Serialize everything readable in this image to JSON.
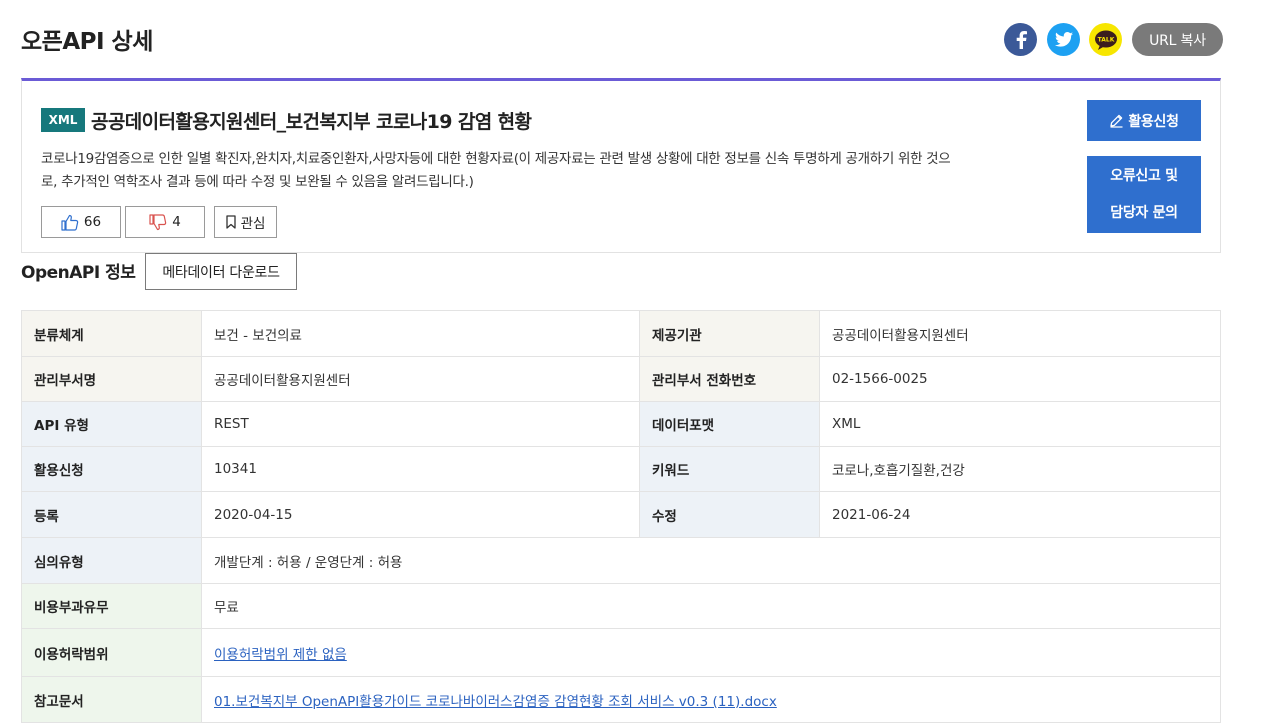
{
  "header": {
    "title": "오픈API 상세",
    "share": {
      "facebook": "facebook-icon",
      "twitter": "twitter-icon",
      "kakao": "kakaotalk-icon",
      "kakao_text": "TALK",
      "url_copy_label": "URL 복사"
    }
  },
  "dataset": {
    "format_badge": "XML",
    "title": "공공데이터활용지원센터_보건복지부 코로나19 감염 현황",
    "description": "코로나19감염증으로 인한 일별 확진자,완치자,치료중인환자,사망자등에 대한 현황자료(이 제공자료는 관련 발생 상황에 대한 정보를 신속 투명하게 공개하기 위한 것으로, 추가적인 역학조사 결과 등에 따라 수정 및 보완될 수 있음을 알려드립니다.)",
    "likes": "66",
    "dislikes": "4",
    "favorite_label": "관심",
    "apply_label": "활용신청",
    "report_line1": "오류신고 및",
    "report_line2": "담당자 문의"
  },
  "section": {
    "title": "OpenAPI 정보",
    "metadata_download_label": "메타데이터 다운로드"
  },
  "info": {
    "category_label": "분류체계",
    "category_value": "보건 - 보건의료",
    "provider_label": "제공기관",
    "provider_value": "공공데이터활용지원센터",
    "dept_label": "관리부서명",
    "dept_value": "공공데이터활용지원센터",
    "phone_label": "관리부서 전화번호",
    "phone_value": "02-1566-0025",
    "api_type_label": "API 유형",
    "api_type_value": "REST",
    "format_label": "데이터포맷",
    "format_value": "XML",
    "applications_label": "활용신청",
    "applications_value": "10341",
    "keywords_label": "키워드",
    "keywords_value": "코로나,호흡기질환,건강",
    "registered_label": "등록",
    "registered_value": "2020-04-15",
    "modified_label": "수정",
    "modified_value": "2021-06-24",
    "review_label": "심의유형",
    "review_value": "개발단계 : 허용 / 운영단계 : 허용",
    "fee_label": "비용부과유무",
    "fee_value": "무료",
    "license_label": "이용허락범위",
    "license_value": "이용허락범위 제한 없음",
    "reference_label": "참고문서",
    "reference_value": "01.보건복지부 OpenAPI활용가이드 코로나바이러스감염증 감염현황 조회 서비스 v0.3 (11).docx"
  }
}
